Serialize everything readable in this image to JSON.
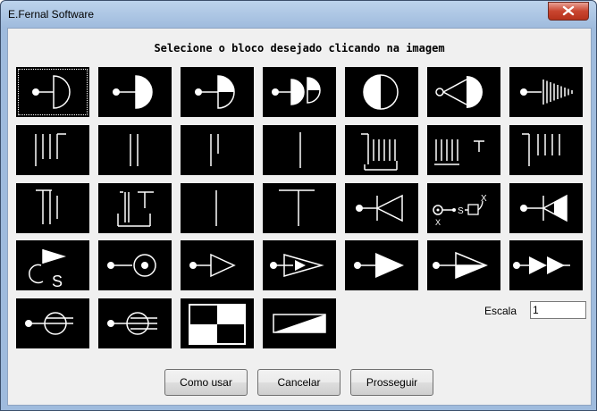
{
  "window": {
    "title": "E.Fernal Software"
  },
  "heading": "Selecione o bloco desejado clicando na imagem",
  "scale": {
    "label": "Escala",
    "value": "1"
  },
  "buttons": {
    "help": "Como usar",
    "cancel": "Cancelar",
    "proceed": "Prosseguir"
  },
  "tiles": [
    {
      "name": "block-tile-1",
      "icon": "half-disc-outline-icon",
      "selected": true
    },
    {
      "name": "block-tile-2",
      "icon": "half-disc-filled-icon"
    },
    {
      "name": "block-tile-3",
      "icon": "half-disc-quarter-filled-icon"
    },
    {
      "name": "block-tile-4",
      "icon": "double-half-disc-icon"
    },
    {
      "name": "block-tile-5",
      "icon": "circle-half-filled-icon"
    },
    {
      "name": "block-tile-6",
      "icon": "cone-speaker-icon"
    },
    {
      "name": "block-tile-7",
      "icon": "horn-array-icon"
    },
    {
      "name": "block-tile-8",
      "icon": "four-lines-icon"
    },
    {
      "name": "block-tile-9",
      "icon": "two-lines-icon"
    },
    {
      "name": "block-tile-10",
      "icon": "two-lines-short-icon"
    },
    {
      "name": "block-tile-11",
      "icon": "single-line-icon"
    },
    {
      "name": "block-tile-12",
      "icon": "stack-base-icon"
    },
    {
      "name": "block-tile-13",
      "icon": "stack-base-t-icon"
    },
    {
      "name": "block-tile-14",
      "icon": "five-lines-icon"
    },
    {
      "name": "block-tile-15",
      "icon": "line-pair-t-icon"
    },
    {
      "name": "block-tile-16",
      "icon": "bracket-t-icon"
    },
    {
      "name": "block-tile-17",
      "icon": "single-line-center-icon"
    },
    {
      "name": "block-tile-18",
      "icon": "t-shape-icon"
    },
    {
      "name": "block-tile-19",
      "icon": "reverse-triangle-icon"
    },
    {
      "name": "block-tile-20",
      "icon": "signal-chain-icon"
    },
    {
      "name": "block-tile-21",
      "icon": "reverse-triangle-filled-icon"
    },
    {
      "name": "block-tile-22",
      "icon": "flag-s-icon"
    },
    {
      "name": "block-tile-23",
      "icon": "target-circle-icon"
    },
    {
      "name": "block-tile-24",
      "icon": "triangle-outline-icon"
    },
    {
      "name": "block-tile-25",
      "icon": "triangle-nested-icon"
    },
    {
      "name": "block-tile-26",
      "icon": "triangle-filled-icon"
    },
    {
      "name": "block-tile-27",
      "icon": "triangle-half-filled-icon"
    },
    {
      "name": "block-tile-28",
      "icon": "double-triangle-icon"
    },
    {
      "name": "block-tile-29",
      "icon": "circle-crossed-icon"
    },
    {
      "name": "block-tile-30",
      "icon": "circle-double-crossed-icon"
    },
    {
      "name": "block-tile-31",
      "icon": "checker-icon"
    },
    {
      "name": "block-tile-32",
      "icon": "ramp-icon"
    }
  ],
  "colors": {
    "tile_bg": "#000000",
    "glyph": "#ffffff",
    "client_bg": "#f0f0f0",
    "close_red": "#c9452f"
  }
}
